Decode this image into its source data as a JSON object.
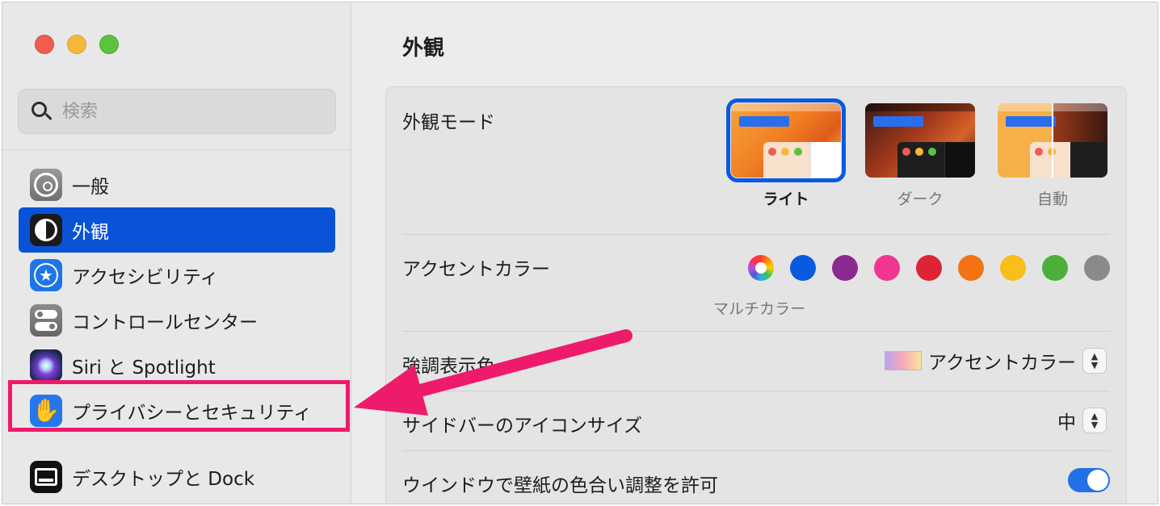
{
  "window": {
    "controls": [
      "close",
      "minimize",
      "zoom"
    ]
  },
  "search": {
    "placeholder": "検索"
  },
  "sidebar": {
    "items": [
      {
        "label": "一般",
        "icon": "gear-icon"
      },
      {
        "label": "外観",
        "icon": "appearance-icon",
        "active": true
      },
      {
        "label": "アクセシビリティ",
        "icon": "accessibility-icon"
      },
      {
        "label": "コントロールセンター",
        "icon": "control-center-icon"
      },
      {
        "label": "Siri と Spotlight",
        "icon": "siri-icon"
      },
      {
        "label": "プライバシーとセキュリティ",
        "icon": "hand-icon"
      },
      {
        "label": "デスクトップと Dock",
        "icon": "dock-icon"
      }
    ]
  },
  "main": {
    "title": "外観",
    "appearance_mode": {
      "label": "外観モード",
      "options": [
        {
          "label": "ライト",
          "selected": true
        },
        {
          "label": "ダーク",
          "selected": false
        },
        {
          "label": "自動",
          "selected": false
        }
      ]
    },
    "accent_color": {
      "label": "アクセントカラー",
      "selected_caption": "マルチカラー",
      "colors": [
        "multicolor",
        "#0a5ae0",
        "#8a2a8e",
        "#f0368f",
        "#dd2434",
        "#f27214",
        "#f8be1c",
        "#4caf3a",
        "#8a8a8a"
      ]
    },
    "highlight_color": {
      "label": "強調表示色",
      "value": "アクセントカラー"
    },
    "sidebar_icon_size": {
      "label": "サイドバーのアイコンサイズ",
      "value": "中"
    },
    "wallpaper_tinting": {
      "label": "ウインドウで壁紙の色合い調整を許可",
      "enabled": true
    }
  },
  "annotation": {
    "highlight_color": "#ee1a6b"
  }
}
